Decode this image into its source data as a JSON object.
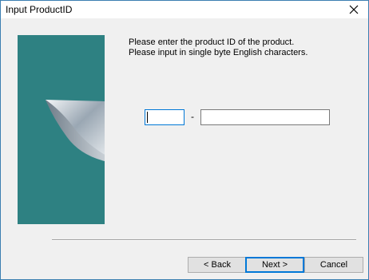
{
  "window": {
    "title": "Input ProductID"
  },
  "message": {
    "line1": "Please enter the product ID of the product.",
    "line2": "Please input in single byte English characters."
  },
  "product_id": {
    "part1_value": "",
    "separator": "-",
    "part2_value": ""
  },
  "buttons": {
    "back": "< Back",
    "next": "Next >",
    "cancel": "Cancel"
  },
  "colors": {
    "banner": "#2e8182",
    "focus": "#0078d7"
  },
  "icons": {
    "close": "close-icon"
  }
}
